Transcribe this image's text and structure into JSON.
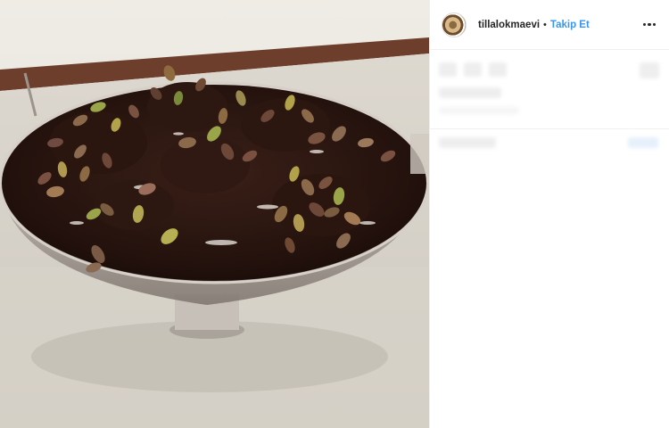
{
  "post": {
    "username": "tillalokmaevi",
    "separator": "•",
    "follow_label": "Takip Et",
    "more_icon": "more-horizontal-icon",
    "avatar_icon": "profile-avatar"
  },
  "photo": {
    "subject": "chocolate-pudding-with-pistachios"
  }
}
